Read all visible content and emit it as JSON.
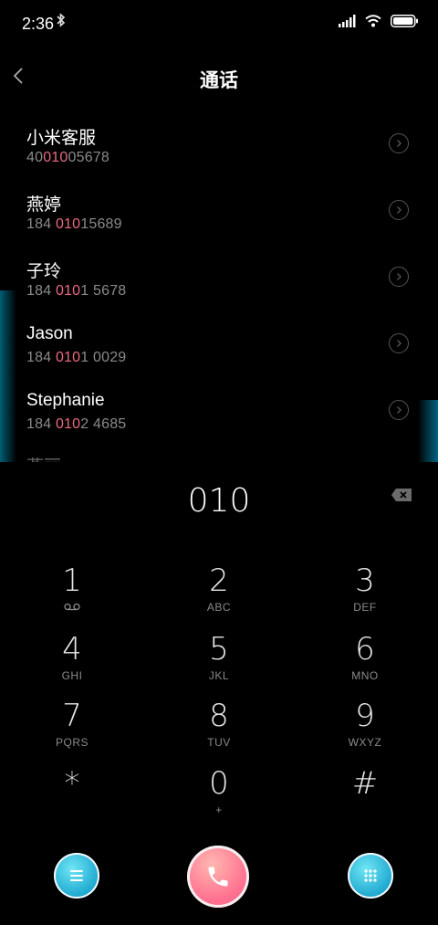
{
  "status": {
    "time": "2:36",
    "bluetooth_glyph": "✱"
  },
  "header": {
    "title": "通话"
  },
  "contacts": [
    {
      "name": "小米客服",
      "num_pre": "40",
      "num_hl": "010",
      "num_post": "05678"
    },
    {
      "name": "燕婷",
      "num_pre": "184 ",
      "num_hl": "010",
      "num_post": "15689"
    },
    {
      "name": "子玲",
      "num_pre": "184 ",
      "num_hl": "010",
      "num_post": "1 5678"
    },
    {
      "name": "Jason",
      "num_pre": "184 ",
      "num_hl": "010",
      "num_post": "1 0029"
    },
    {
      "name": "Stephanie",
      "num_pre": "184 ",
      "num_hl": "010",
      "num_post": "2 4685"
    }
  ],
  "partial_contact": "燕丽",
  "dialer": {
    "entered": "010",
    "keys": [
      {
        "digit": "1",
        "letters": ""
      },
      {
        "digit": "2",
        "letters": "ABC"
      },
      {
        "digit": "3",
        "letters": "DEF"
      },
      {
        "digit": "4",
        "letters": "GHI"
      },
      {
        "digit": "5",
        "letters": "JKL"
      },
      {
        "digit": "6",
        "letters": "MNO"
      },
      {
        "digit": "7",
        "letters": "PQRS"
      },
      {
        "digit": "8",
        "letters": "TUV"
      },
      {
        "digit": "9",
        "letters": "WXYZ"
      },
      {
        "digit": "*",
        "letters": ""
      },
      {
        "digit": "0",
        "letters": "+"
      },
      {
        "digit": "#",
        "letters": ""
      }
    ]
  },
  "icons": {
    "back": "chevron-left-icon",
    "info": "chevron-right-circle-icon",
    "backspace": "backspace-icon",
    "voicemail": "voicemail-icon",
    "menu": "menu-icon",
    "call": "phone-icon",
    "keypad": "keypad-icon"
  },
  "colors": {
    "highlight": "#e96a80",
    "accent_cyan": "#1da7cf",
    "call_pink": "#ff6f8f"
  }
}
